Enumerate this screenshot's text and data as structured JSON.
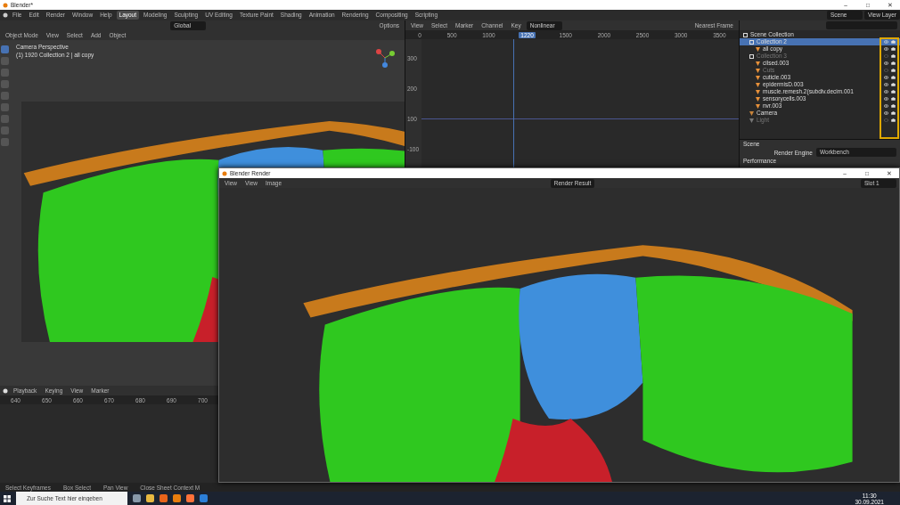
{
  "window": {
    "title": "Blender*",
    "controls": [
      "–",
      "□",
      "✕"
    ]
  },
  "menu": [
    "File",
    "Edit",
    "Render",
    "Window",
    "Help"
  ],
  "workspaces": [
    {
      "label": "Layout",
      "selected": true
    },
    {
      "label": "Modeling",
      "selected": false
    },
    {
      "label": "Sculpting",
      "selected": false
    },
    {
      "label": "UV Editing",
      "selected": false
    },
    {
      "label": "Texture Paint",
      "selected": false
    },
    {
      "label": "Shading",
      "selected": false
    },
    {
      "label": "Animation",
      "selected": false
    },
    {
      "label": "Rendering",
      "selected": false
    },
    {
      "label": "Compositing",
      "selected": false
    },
    {
      "label": "Scripting",
      "selected": false
    }
  ],
  "scene_selector": {
    "scene": "Scene",
    "view_layer": "View Layer"
  },
  "viewport": {
    "tool_header": {
      "orientation": "Global",
      "options": "Options"
    },
    "header": [
      "Object Mode",
      "View",
      "Select",
      "Add",
      "Object"
    ],
    "overlay_title": "Camera Perspective",
    "overlay_info": "(1) 1920 Collection 2 | all copy"
  },
  "graph": {
    "menu": [
      "View",
      "Select",
      "Marker",
      "Channel",
      "Key"
    ],
    "mode": "Nonlinear",
    "snap": "Nearest Frame",
    "ruler": [
      "0",
      "500",
      "1000",
      "1500",
      "2000",
      "2500",
      "3000",
      "3500"
    ],
    "current_frame": "1220",
    "y_labels": [
      "300",
      "200",
      "100",
      "-100"
    ]
  },
  "outliner": {
    "root": "Scene Collection",
    "items": [
      {
        "label": "Collection 2",
        "kind": "collection",
        "selected": true,
        "dimmed": false,
        "children": [
          {
            "label": "all copy",
            "kind": "mesh",
            "selected": false,
            "dimmed": false
          }
        ]
      },
      {
        "label": "Collection 3",
        "kind": "collection",
        "selected": false,
        "dimmed": true,
        "children": [
          {
            "label": "cilsed.003",
            "kind": "mesh",
            "selected": false,
            "dimmed": false
          },
          {
            "label": "Cuts",
            "kind": "mesh",
            "selected": false,
            "dimmed": true
          },
          {
            "label": "cuticle.003",
            "kind": "mesh",
            "selected": false,
            "dimmed": false
          },
          {
            "label": "epidermisD.003",
            "kind": "mesh",
            "selected": false,
            "dimmed": false
          },
          {
            "label": "muscle.remesh.2(subdiv.decim.001",
            "kind": "mesh",
            "selected": false,
            "dimmed": false
          },
          {
            "label": "sensorycells.003",
            "kind": "mesh",
            "selected": false,
            "dimmed": false
          },
          {
            "label": "nvr.003",
            "kind": "mesh",
            "selected": false,
            "dimmed": false
          }
        ]
      },
      {
        "label": "Camera",
        "kind": "camera",
        "selected": false,
        "dimmed": false
      },
      {
        "label": "Light",
        "kind": "light",
        "selected": false,
        "dimmed": true
      }
    ]
  },
  "properties": {
    "context": "Scene",
    "engine_label": "Render Engine",
    "engine": "Workbench",
    "panel": "Performance"
  },
  "timeline": {
    "menu": [
      "Playback",
      "Keying",
      "View",
      "Marker"
    ],
    "ruler": [
      "640",
      "650",
      "660",
      "670",
      "680",
      "690",
      "700"
    ]
  },
  "status_bar": [
    "Select Keyframes",
    "Box Select",
    "Pan View",
    "Close Sheet Context M"
  ],
  "render_window": {
    "title": "Blender Render",
    "menu": [
      "View",
      "View",
      "Image"
    ],
    "image": "Render Result",
    "slot": "Slot 1",
    "controls": [
      "–",
      "□",
      "✕"
    ]
  },
  "taskbar": {
    "search": {
      "placeholder": "Zur Suche Text hier eingeben"
    },
    "time": "11:30",
    "date": "30.09.2021"
  }
}
